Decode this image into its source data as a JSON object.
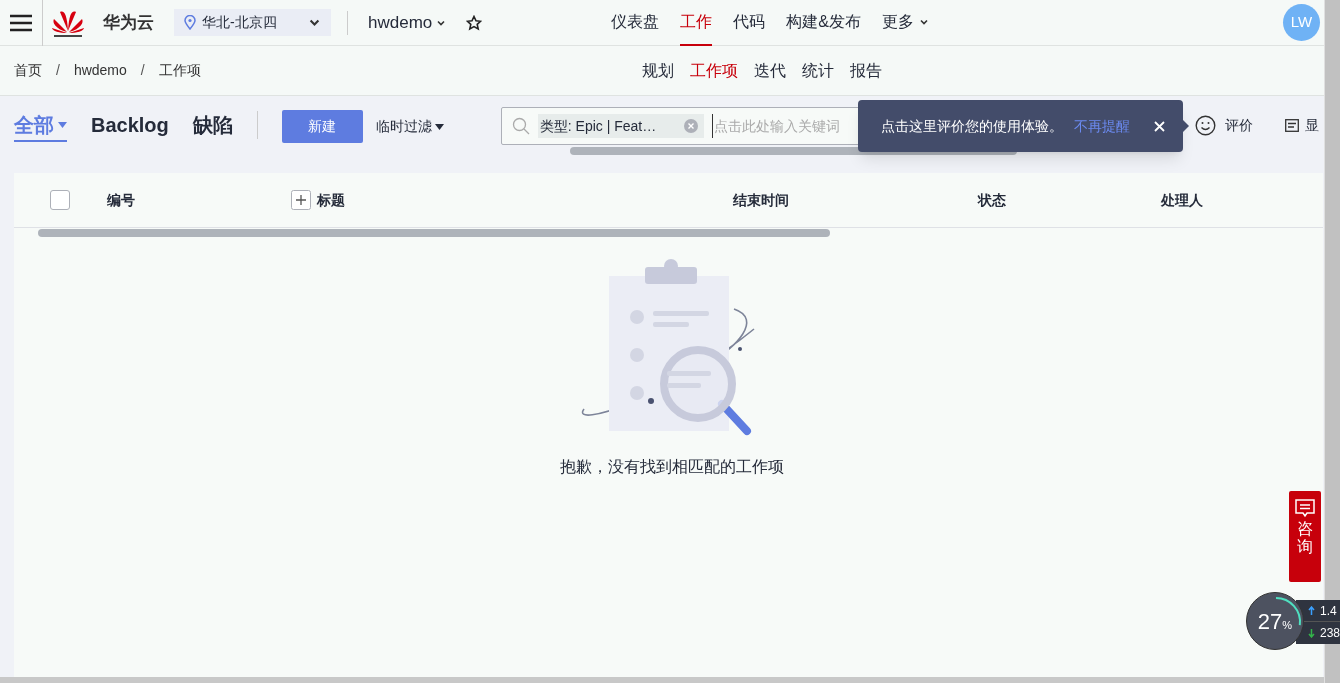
{
  "header": {
    "brand": "华为云",
    "region": "华北-北京四",
    "project": "hwdemo",
    "nav": [
      {
        "label": "仪表盘",
        "selected": false,
        "dropdown": false
      },
      {
        "label": "工作",
        "selected": true,
        "dropdown": false
      },
      {
        "label": "代码",
        "selected": false,
        "dropdown": false
      },
      {
        "label": "构建&发布",
        "selected": false,
        "dropdown": false
      },
      {
        "label": "更多",
        "selected": false,
        "dropdown": true
      }
    ],
    "avatar": "LW"
  },
  "breadcrumb": [
    {
      "kind": "link",
      "text": "首页"
    },
    {
      "kind": "separator",
      "text": "/"
    },
    {
      "kind": "link",
      "text": "hwdemo"
    },
    {
      "kind": "separator",
      "text": "/"
    },
    {
      "kind": "link",
      "text": "工作项"
    }
  ],
  "subnav": [
    {
      "label": "规划",
      "selected": false
    },
    {
      "label": "工作项",
      "selected": true
    },
    {
      "label": "迭代",
      "selected": false
    },
    {
      "label": "统计",
      "selected": false
    },
    {
      "label": "报告",
      "selected": false
    }
  ],
  "view_tabs": [
    {
      "label": "全部",
      "selected": true,
      "dropdown": true
    },
    {
      "label": "Backlog",
      "selected": false,
      "dropdown": false
    },
    {
      "label": "缺陷",
      "selected": false,
      "dropdown": false
    }
  ],
  "new_button": "新建",
  "temp_filter": "临时过滤",
  "search": {
    "chip": "类型: Epic | Feat…",
    "placeholder": "点击此处输入关键词"
  },
  "tooltip": {
    "text": "点击这里评价您的使用体验。",
    "link": "不再提醒"
  },
  "rate": "评价",
  "display": "显",
  "table": {
    "select_all_checked": false,
    "columns": [
      "编号",
      "标题",
      "结束时间",
      "状态",
      "处理人"
    ],
    "empty": "抱歉，没有找到相匹配的工作项"
  },
  "consult": "咨询",
  "monitor": {
    "percent": "27",
    "unit": "%",
    "up": "1.4",
    "down": "238"
  }
}
